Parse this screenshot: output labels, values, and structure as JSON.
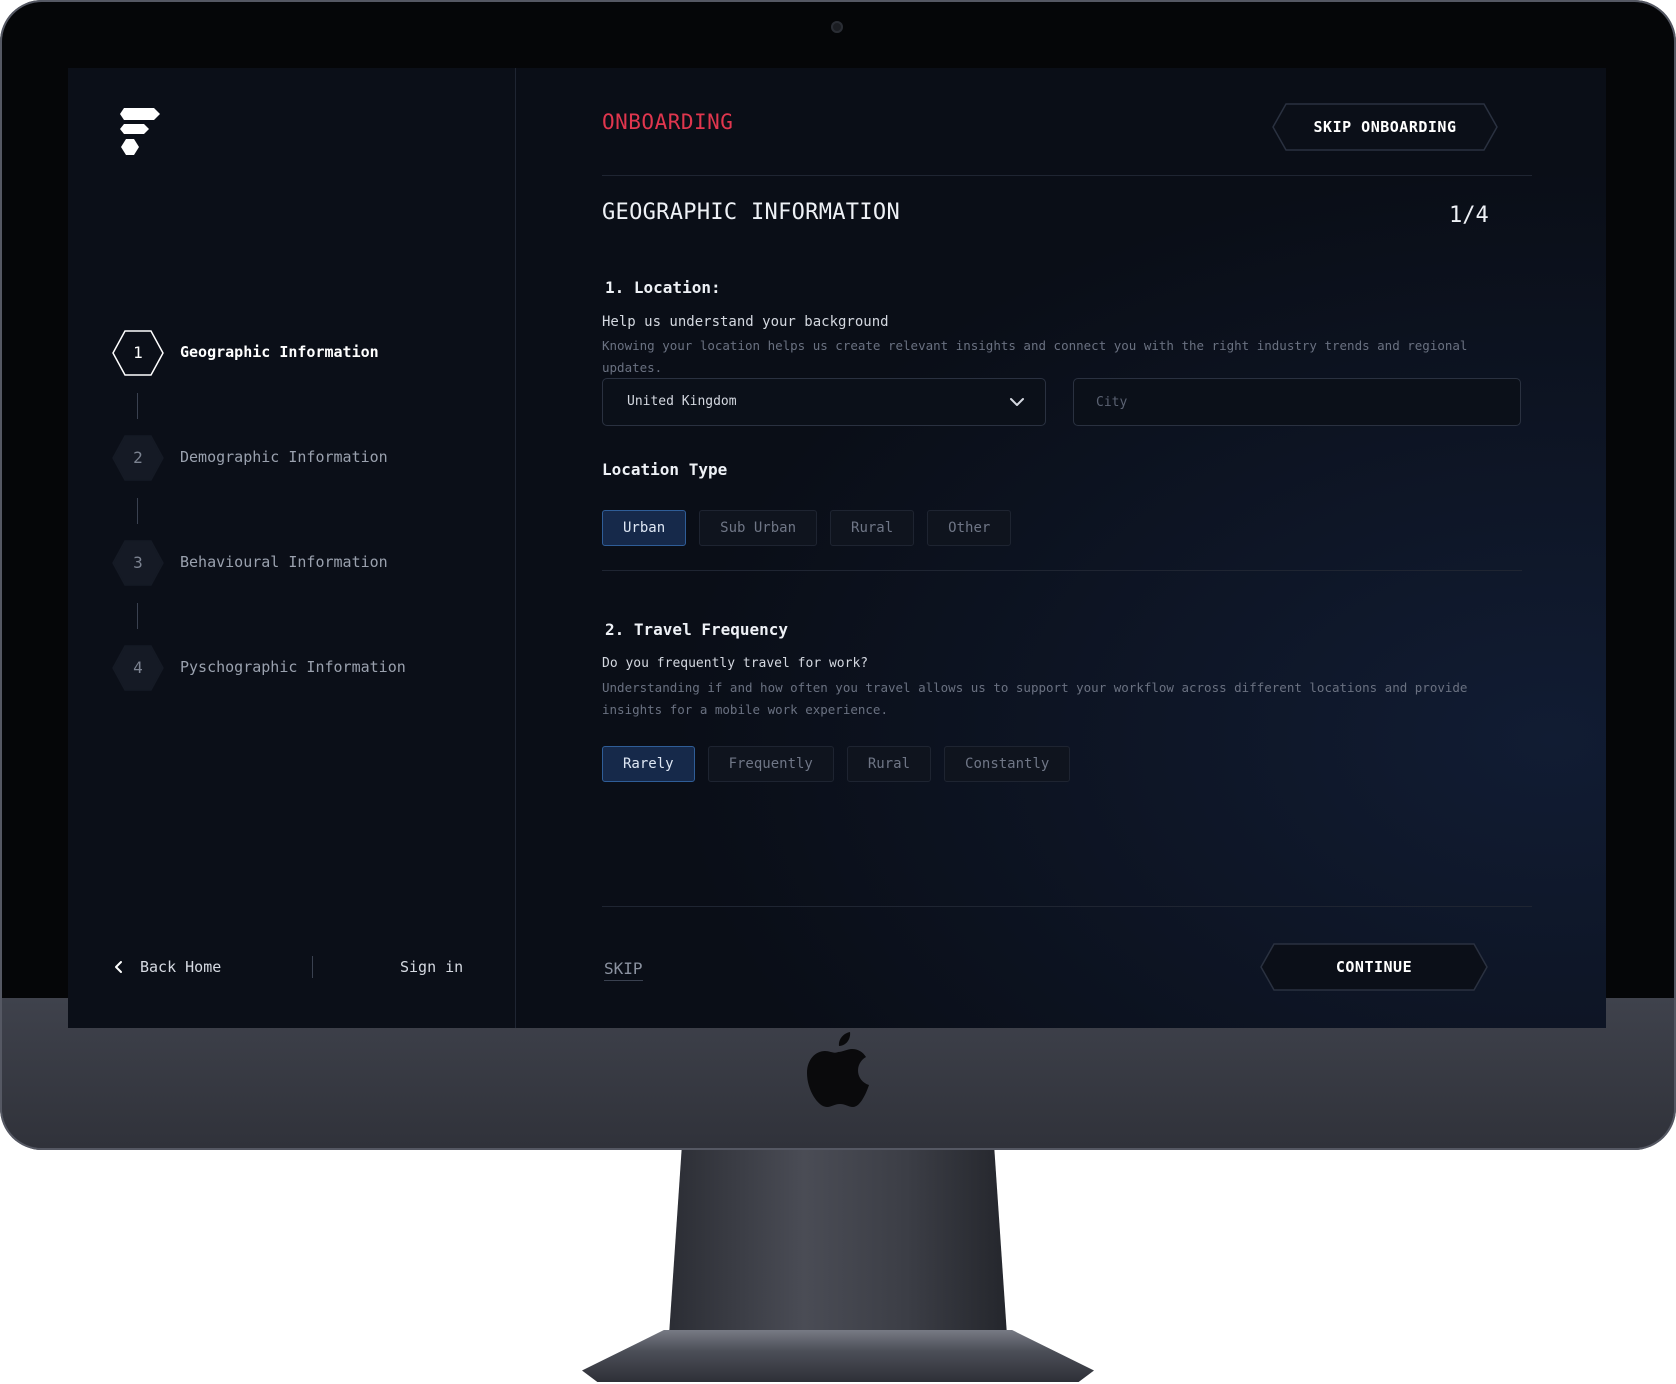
{
  "app": {
    "header_title": "ONBOARDING",
    "skip_onboarding_label": "SKIP ONBOARDING",
    "accent_color": "#e0364e",
    "selected_chip_color": "#16294a"
  },
  "sidebar": {
    "steps": [
      {
        "number": "1",
        "label": "Geographic Information",
        "active": true
      },
      {
        "number": "2",
        "label": "Demographic Information",
        "active": false
      },
      {
        "number": "3",
        "label": "Behavioural Information",
        "active": false
      },
      {
        "number": "4",
        "label": "Pyschographic Information",
        "active": false
      }
    ],
    "back_home_label": "Back Home",
    "sign_in_label": "Sign in"
  },
  "main": {
    "section_title": "GEOGRAPHIC INFORMATION",
    "progress": "1/4",
    "q1": {
      "title": "1. Location:",
      "subtitle": "Help us understand your background",
      "description": "Knowing your location helps us create relevant insights and connect you with the right industry trends and regional updates.",
      "country_value": "United Kingdom",
      "city_placeholder": "City",
      "location_type_label": "Location Type",
      "location_types": [
        "Urban",
        "Sub Urban",
        "Rural",
        "Other"
      ],
      "selected_location_type": "Urban"
    },
    "q2": {
      "title": "2. Travel Frequency",
      "subtitle": "Do you frequently travel for work?",
      "description": "Understanding if and how often you travel allows us to support your workflow across different locations and provide insights for a mobile work experience.",
      "options": [
        "Rarely",
        "Frequently",
        "Rural",
        "Constantly"
      ],
      "selected": "Rarely"
    },
    "skip_label": "SKIP",
    "continue_label": "CONTINUE"
  }
}
